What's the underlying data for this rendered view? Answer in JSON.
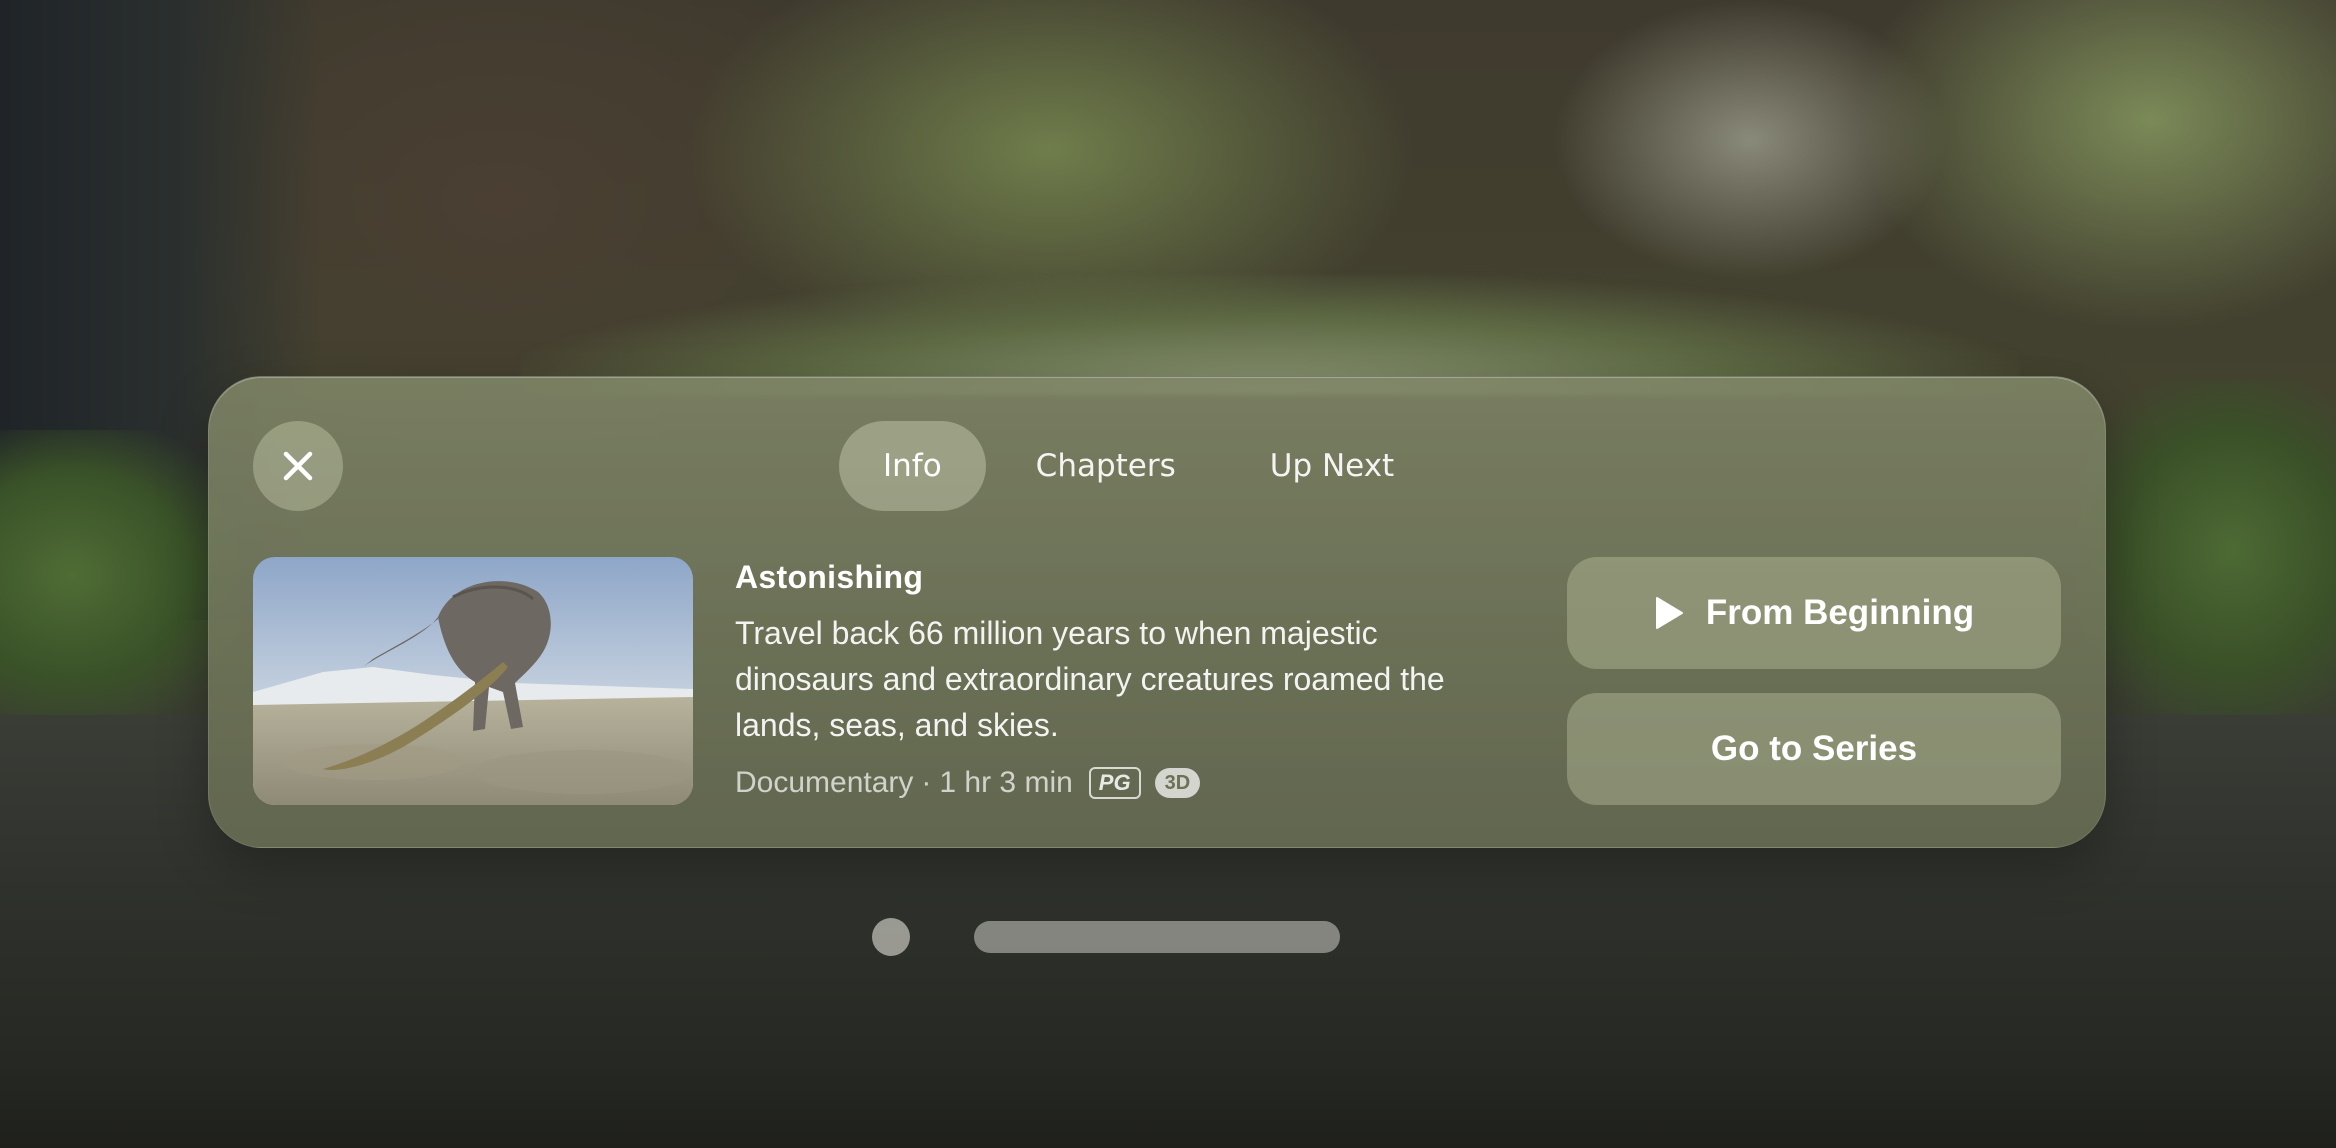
{
  "tabs": [
    {
      "label": "Info",
      "active": true
    },
    {
      "label": "Chapters",
      "active": false
    },
    {
      "label": "Up Next",
      "active": false
    }
  ],
  "episode": {
    "title": "Astonishing",
    "description": "Travel back 66 million years to when majestic dinosaurs and extraordinary creatures roamed the lands, seas, and skies.",
    "genre": "Documentary",
    "separator": "·",
    "duration": "1 hr 3 min",
    "rating": "PG",
    "format": "3D"
  },
  "actions": {
    "from_beginning": "From Beginning",
    "go_to_series": "Go to Series"
  },
  "icons": {
    "close": "close-icon",
    "play": "play-icon"
  },
  "colors": {
    "panel": "#7a7f62",
    "button": "#a3a68a",
    "text": "#ffffff"
  }
}
